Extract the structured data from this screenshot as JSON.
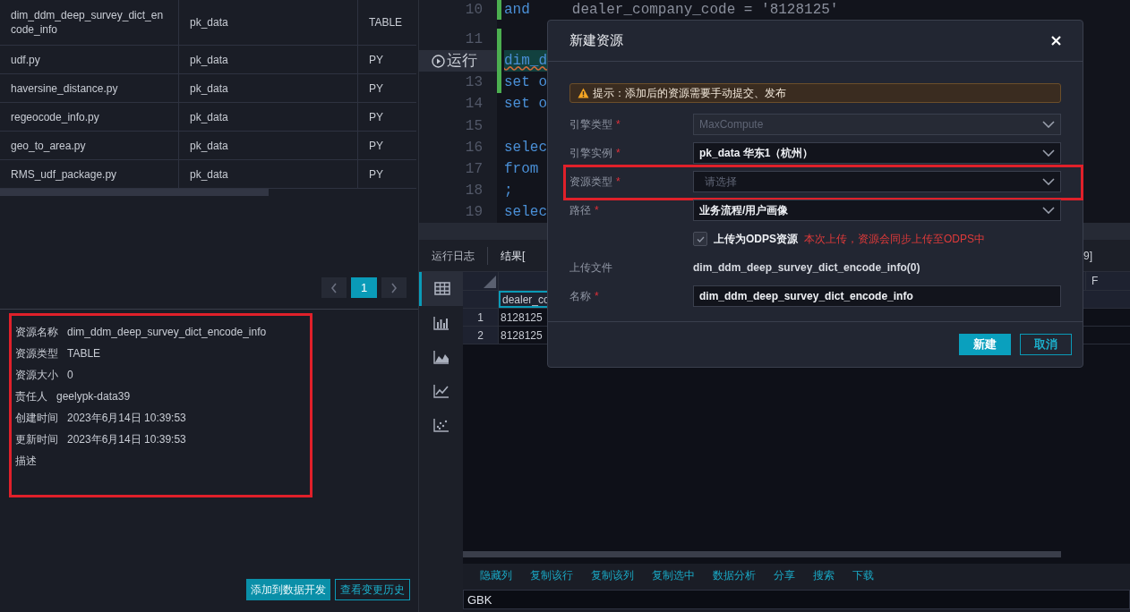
{
  "resource_table": {
    "rows": [
      {
        "name": "dim_ddm_deep_survey_dict_encode_info",
        "owner": "pk_data",
        "type": "TABLE"
      },
      {
        "name": "udf.py",
        "owner": "pk_data",
        "type": "PY"
      },
      {
        "name": "haversine_distance.py",
        "owner": "pk_data",
        "type": "PY"
      },
      {
        "name": "regeocode_info.py",
        "owner": "pk_data",
        "type": "PY"
      },
      {
        "name": "geo_to_area.py",
        "owner": "pk_data",
        "type": "PY"
      },
      {
        "name": "RMS_udf_package.py",
        "owner": "pk_data",
        "type": "PY"
      }
    ]
  },
  "pagination": {
    "pages": [
      {
        "label": "1",
        "selected": true
      }
    ]
  },
  "details": {
    "highlighted": true,
    "fields": [
      {
        "label": "资源名称",
        "value": "dim_ddm_deep_survey_dict_encode_info"
      },
      {
        "label": "资源类型",
        "value": "TABLE"
      },
      {
        "label": "资源大小",
        "value": "0"
      },
      {
        "label": "责任人",
        "value": "geelypk-data39"
      },
      {
        "label": "创建时间",
        "value": "2023年6月14日 10:39:53"
      },
      {
        "label": "更新时间",
        "value": "2023年6月14日 10:39:53"
      },
      {
        "label": "描述"
      }
    ]
  },
  "detail_buttons": [
    {
      "label": "添加到数据开发",
      "kind": "primary"
    },
    {
      "label": "查看变更历史",
      "kind": "outline"
    }
  ],
  "editor": {
    "lines": [
      {
        "kind": "code",
        "number": "10",
        "text": "and",
        "rest": "dealer_company_code = '8128125'",
        "modified": true
      },
      {
        "kind": "code",
        "number": "11",
        "modified": true
      },
      {
        "kind": "run",
        "label": "运行",
        "text": "dim_d",
        "modified": true
      },
      {
        "kind": "code",
        "number": "13",
        "text": "set o",
        "modified": true
      },
      {
        "kind": "code",
        "number": "14",
        "text": "set o",
        "modified": false
      },
      {
        "kind": "code",
        "number": "15",
        "modified": false
      },
      {
        "kind": "code",
        "number": "16",
        "text": "selec",
        "modified": false
      },
      {
        "kind": "code",
        "number": "17",
        "text": "from",
        "modified": false
      },
      {
        "kind": "code",
        "number": "18",
        "text": ";",
        "modified": false
      },
      {
        "kind": "code",
        "number": "19",
        "text": "selec",
        "modified": false
      }
    ]
  },
  "result_tabs": [
    {
      "label": "运行日志",
      "selected": false
    },
    {
      "label": "结果[",
      "selected": true
    }
  ],
  "result_tab_tail": "9]",
  "view_icons": [
    {
      "kind": "table",
      "selected": true
    },
    {
      "kind": "bar",
      "selected": false
    },
    {
      "kind": "area",
      "selected": false
    },
    {
      "kind": "line",
      "selected": false
    },
    {
      "kind": "scatter",
      "selected": false
    }
  ],
  "grid": {
    "last_column": "F",
    "header_row": {
      "value": "dealer_co",
      "selected": true
    },
    "rows": [
      {
        "number": "1",
        "value": "8128125"
      },
      {
        "number": "2",
        "value": "8128125"
      }
    ]
  },
  "grid_actions": [
    "隐藏列",
    "复制该行",
    "复制该列",
    "复制选中",
    "数据分析",
    "分享",
    "搜索",
    "下载"
  ],
  "encoding": {
    "value": "GBK"
  },
  "dialog": {
    "title": "新建资源",
    "notice": "提示：添加后的资源需要手动提交、发布",
    "fields": [
      {
        "kind": "select",
        "label": "引擎类型",
        "required_mark": "*",
        "value": "MaxCompute",
        "disabled": true,
        "highlighted": false
      },
      {
        "kind": "select",
        "label": "引擎实例",
        "required_mark": "*",
        "value": "pk_data 华东1（杭州）",
        "disabled": false,
        "highlighted": false
      },
      {
        "kind": "select",
        "label": "资源类型",
        "required_mark": "*",
        "placeholder": "请选择",
        "disabled": false,
        "highlighted": true
      },
      {
        "kind": "select",
        "label": "路径",
        "required_mark": "*",
        "value": "业务流程/用户画像",
        "disabled": false,
        "highlighted": false
      },
      {
        "kind": "checkbox",
        "label": "上传为ODPS资源",
        "checked": true,
        "note": "本次上传，资源会同步上传至ODPS中"
      },
      {
        "kind": "text",
        "label": "上传文件",
        "value": "dim_ddm_deep_survey_dict_encode_info(0)"
      },
      {
        "kind": "input",
        "label": "名称",
        "required_mark": "*",
        "value": "dim_ddm_deep_survey_dict_encode_info"
      }
    ],
    "buttons": [
      {
        "label": "新建",
        "kind": "primary"
      },
      {
        "label": "取消",
        "kind": "outline"
      }
    ]
  }
}
